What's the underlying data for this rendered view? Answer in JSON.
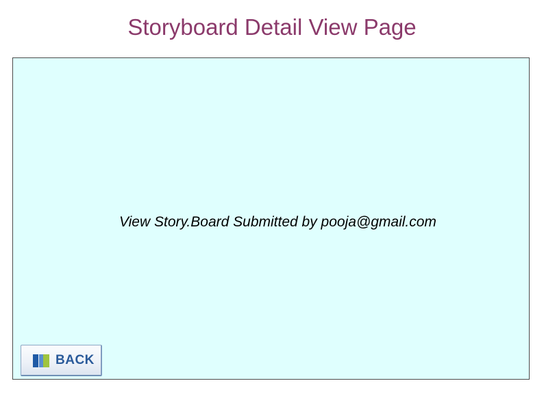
{
  "page": {
    "title": "Storyboard Detail View Page"
  },
  "content": {
    "submitted_text": "View Story.Board Submitted by pooja@gmail.com",
    "background_color": "#dffffe"
  },
  "back_button": {
    "label": "BACK",
    "icon": "back-icon"
  },
  "colors": {
    "title": "#8b3a6b",
    "button_text": "#2a5a9a",
    "icon_blue": "#1f5aa6",
    "icon_green": "#9fc43f"
  }
}
